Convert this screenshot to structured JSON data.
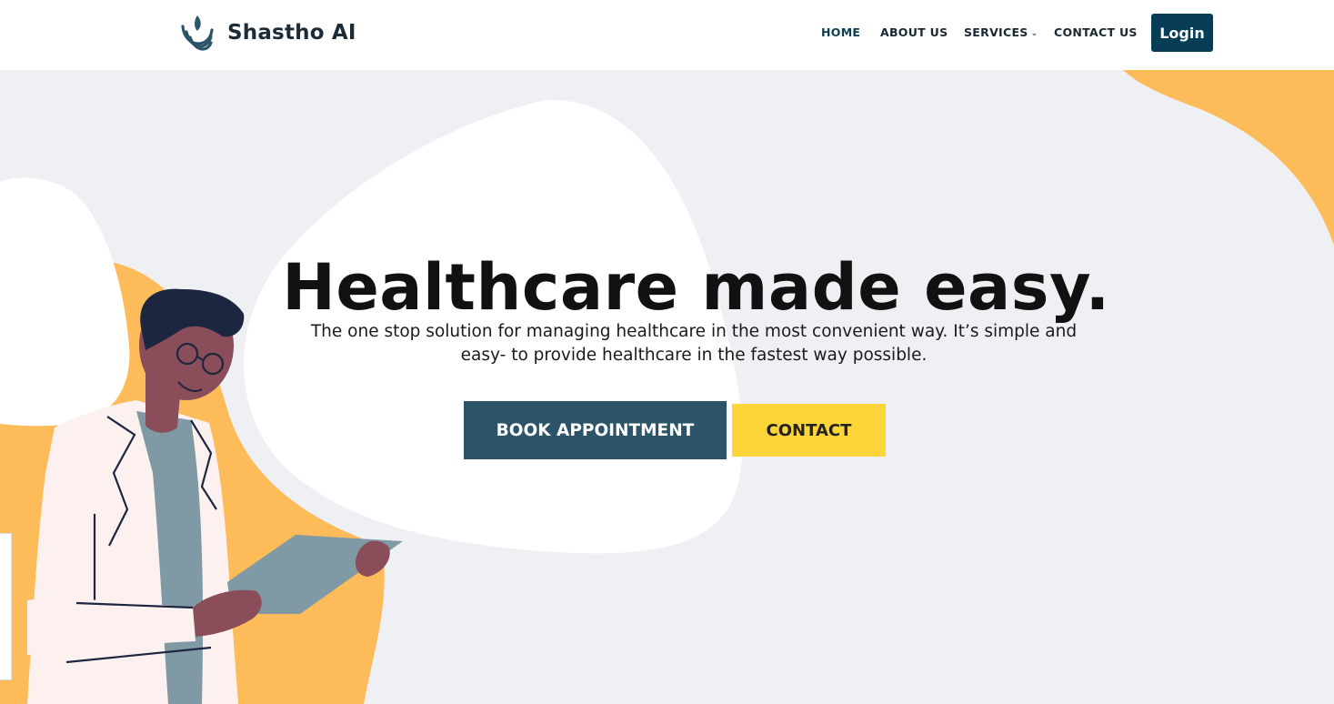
{
  "brand": {
    "name": "Shastho AI",
    "logo_icon": "wave-drop-logo-icon"
  },
  "nav": {
    "items": [
      {
        "label": "HOME",
        "active": true
      },
      {
        "label": "ABOUT US",
        "active": false
      },
      {
        "label": "SERVICES",
        "active": false,
        "has_dropdown": true,
        "dropdown_icon": "chevron-down-icon"
      },
      {
        "label": "CONTACT US",
        "active": false
      }
    ],
    "login_label": "Login"
  },
  "hero": {
    "title": "Healthcare made easy.",
    "subtitle": "The one stop solution for managing healthcare in the most convenient way. It’s simple and easy- to provide healthcare in the fastest way possible.",
    "book_label": "BOOK APPOINTMENT",
    "contact_label": "CONTACT",
    "illustration": "doctor-with-clipboard-illustration"
  },
  "colors": {
    "page_bg": "#eff0f4",
    "accent_orange": "#fdbb5a",
    "primary_dark": "#073d57",
    "book_button": "#2c5468",
    "contact_button": "#fdd538",
    "text": "#111111"
  }
}
